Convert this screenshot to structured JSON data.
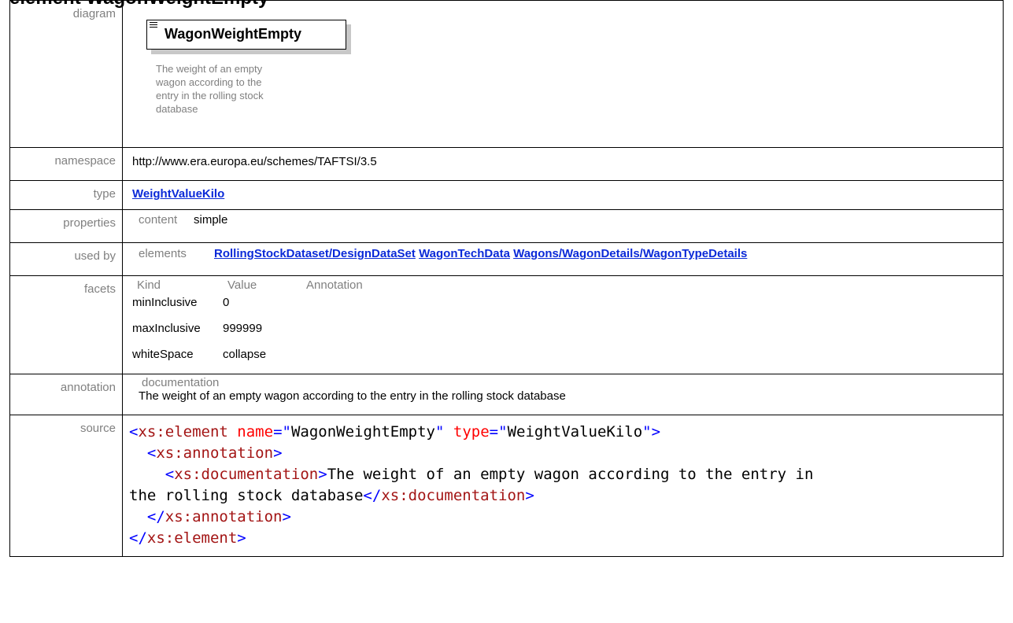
{
  "heading": "element WagonWeightEmpty",
  "diagram": {
    "label": "diagram",
    "element_name": "WagonWeightEmpty",
    "documentation_lines": [
      "The weight of an empty",
      "wagon according to the",
      "entry in the rolling stock",
      "database"
    ]
  },
  "namespace": {
    "label": "namespace",
    "value": "http://www.era.europa.eu/schemes/TAFTSI/3.5"
  },
  "type": {
    "label": "type",
    "value": "WeightValueKilo"
  },
  "properties": {
    "label": "properties",
    "key": "content",
    "value": "simple"
  },
  "used_by": {
    "label": "used by",
    "key": "elements",
    "links": [
      "RollingStockDataset/DesignDataSet",
      "WagonTechData",
      "Wagons/WagonDetails/WagonTypeDetails"
    ]
  },
  "facets": {
    "label": "facets",
    "headers": [
      "Kind",
      "Value",
      "Annotation"
    ],
    "rows": [
      {
        "kind": "minInclusive",
        "value": "0"
      },
      {
        "kind": "maxInclusive",
        "value": "999999"
      },
      {
        "kind": "whiteSpace",
        "value": "collapse"
      }
    ]
  },
  "annotation": {
    "label": "annotation",
    "key": "documentation",
    "text": "The weight of an empty wagon according to the entry in the rolling stock database"
  },
  "source": {
    "label": "source",
    "lt": "<",
    "gt": ">",
    "close_lt": "</",
    "eq": "=",
    "quote": "\"",
    "el_tag": "xs:element",
    "attr_name": "name",
    "name_val": "WagonWeightEmpty",
    "attr_type": "type",
    "type_val": "WeightValueKilo",
    "ann_tag": "xs:annotation",
    "doc_tag": "xs:documentation",
    "doc_text_1": "The weight of an empty wagon according to the entry in",
    "doc_text_2": "the rolling stock database"
  }
}
